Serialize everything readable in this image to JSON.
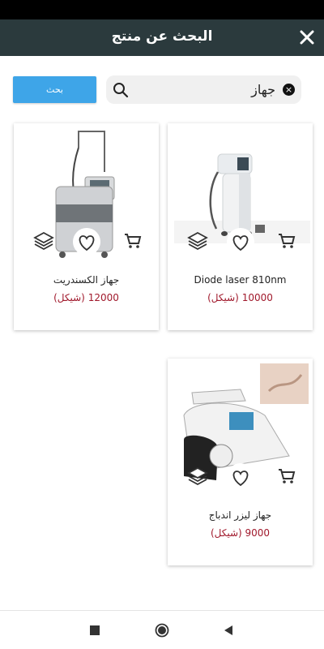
{
  "header": {
    "title": "البحث عن منتج",
    "close_icon": "close-icon"
  },
  "search": {
    "button_label": "بحث",
    "query": "جهاز",
    "placeholder": "",
    "clear_symbol": "×"
  },
  "colors": {
    "app_bar": "#2b3a3d",
    "accent": "#3ea5e8",
    "price": "#a0182b"
  },
  "products": [
    {
      "name": "Diode laser 810nm",
      "price": "10000 (شيكل)"
    },
    {
      "name": "جهاز الكسندريت",
      "price": "12000 (شيكل)"
    },
    {
      "name": "جهاز ليزر اندباج",
      "price": "9000 (شيكل)"
    }
  ],
  "nav": {
    "back_icon": "back-triangle-icon",
    "home_icon": "home-circle-icon",
    "recents_icon": "recents-square-icon"
  }
}
